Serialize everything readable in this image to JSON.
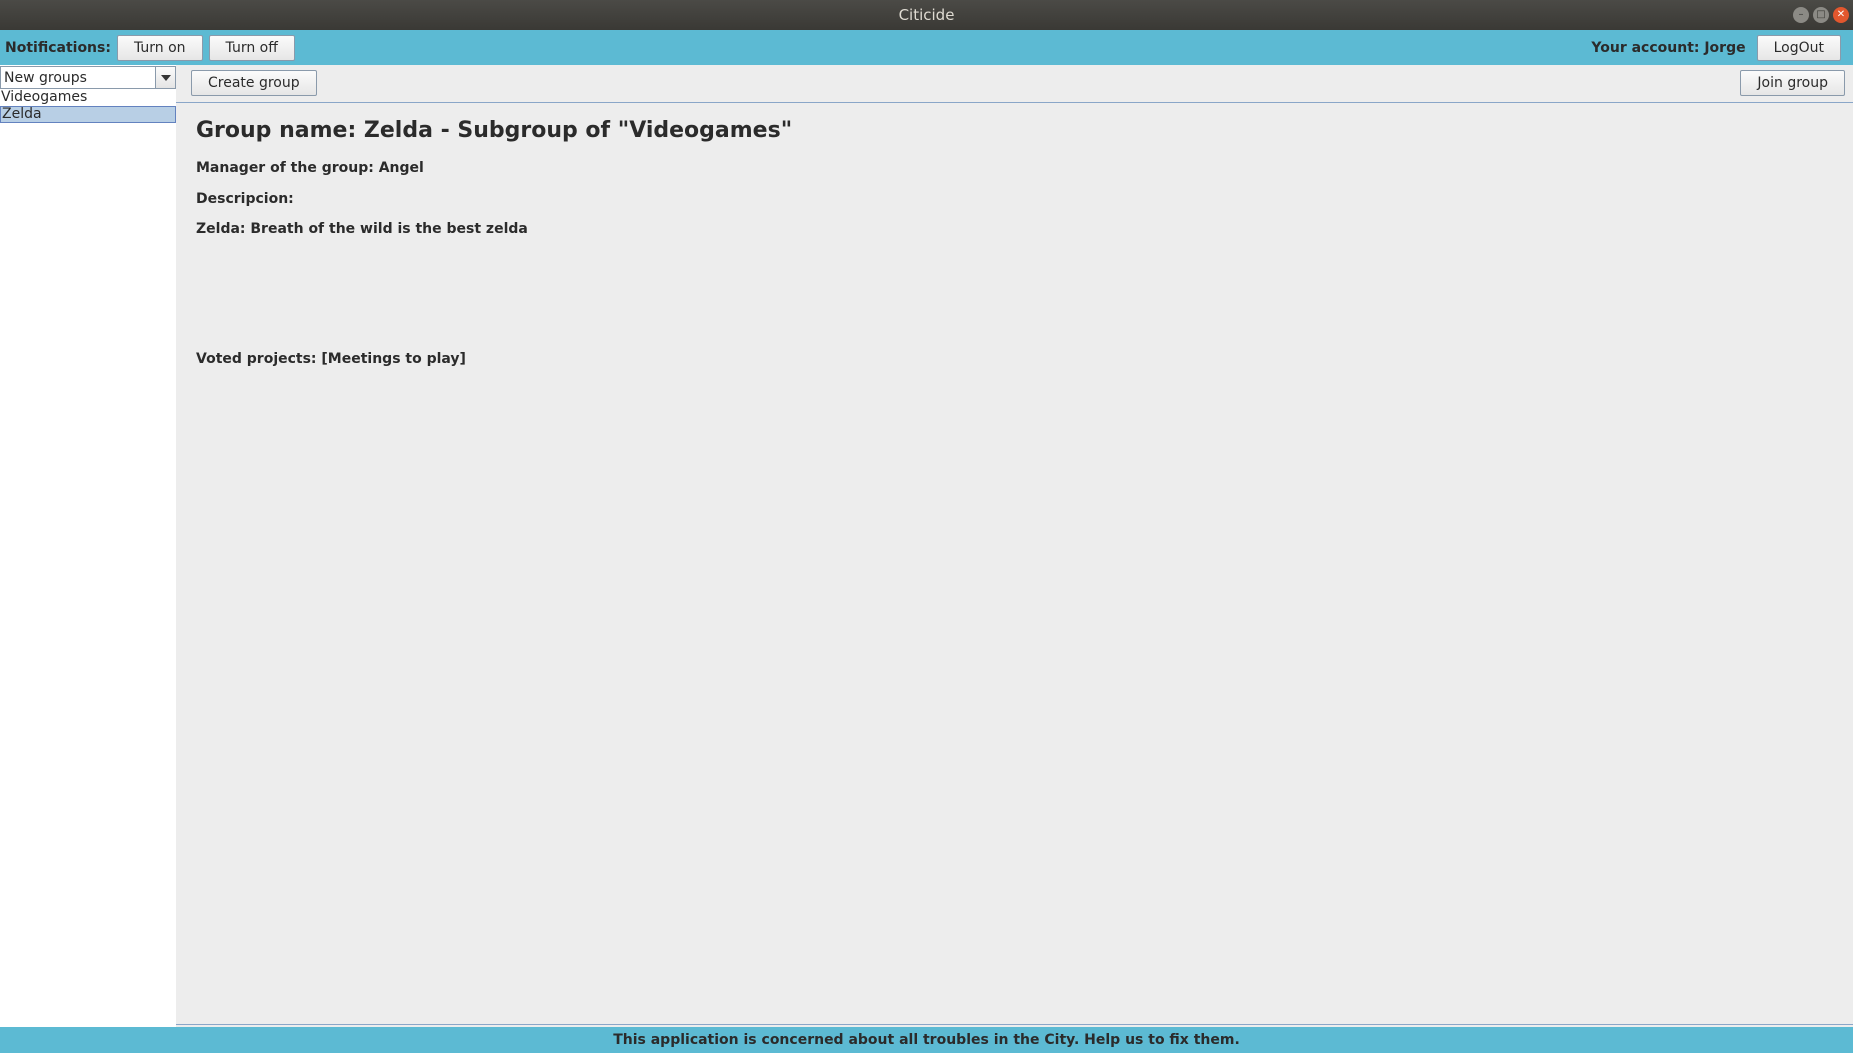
{
  "window": {
    "title": "Citicide",
    "controls": [
      "minimize-icon",
      "maximize-icon",
      "close-icon"
    ]
  },
  "notifications": {
    "label": "Notifications:",
    "turn_on_label": "Turn on",
    "turn_off_label": "Turn off"
  },
  "account": {
    "label": "Your account: Jorge",
    "logout_label": "LogOut"
  },
  "sidebar": {
    "filter_selected": "New groups",
    "groups": [
      {
        "label": "Videogames",
        "selected": false
      },
      {
        "label": "Zelda",
        "selected": true
      }
    ]
  },
  "toolbar": {
    "create_label": "Create group",
    "join_label": "Join group"
  },
  "group": {
    "title": "Group name: Zelda - Subgroup of \"Videogames\"",
    "manager": "Manager of the group: Angel",
    "description_label": "Descripcion:",
    "description": "Zelda: Breath of the wild is the best zelda",
    "voted_projects": "Voted projects: [Meetings to play]"
  },
  "footer": {
    "text": "This application is concerned about all troubles in the City. Help us to fix them."
  },
  "colors": {
    "accent_bar": "#5cbad3",
    "selection": "#b8cfe5",
    "titlebar": "#3c3b37"
  }
}
